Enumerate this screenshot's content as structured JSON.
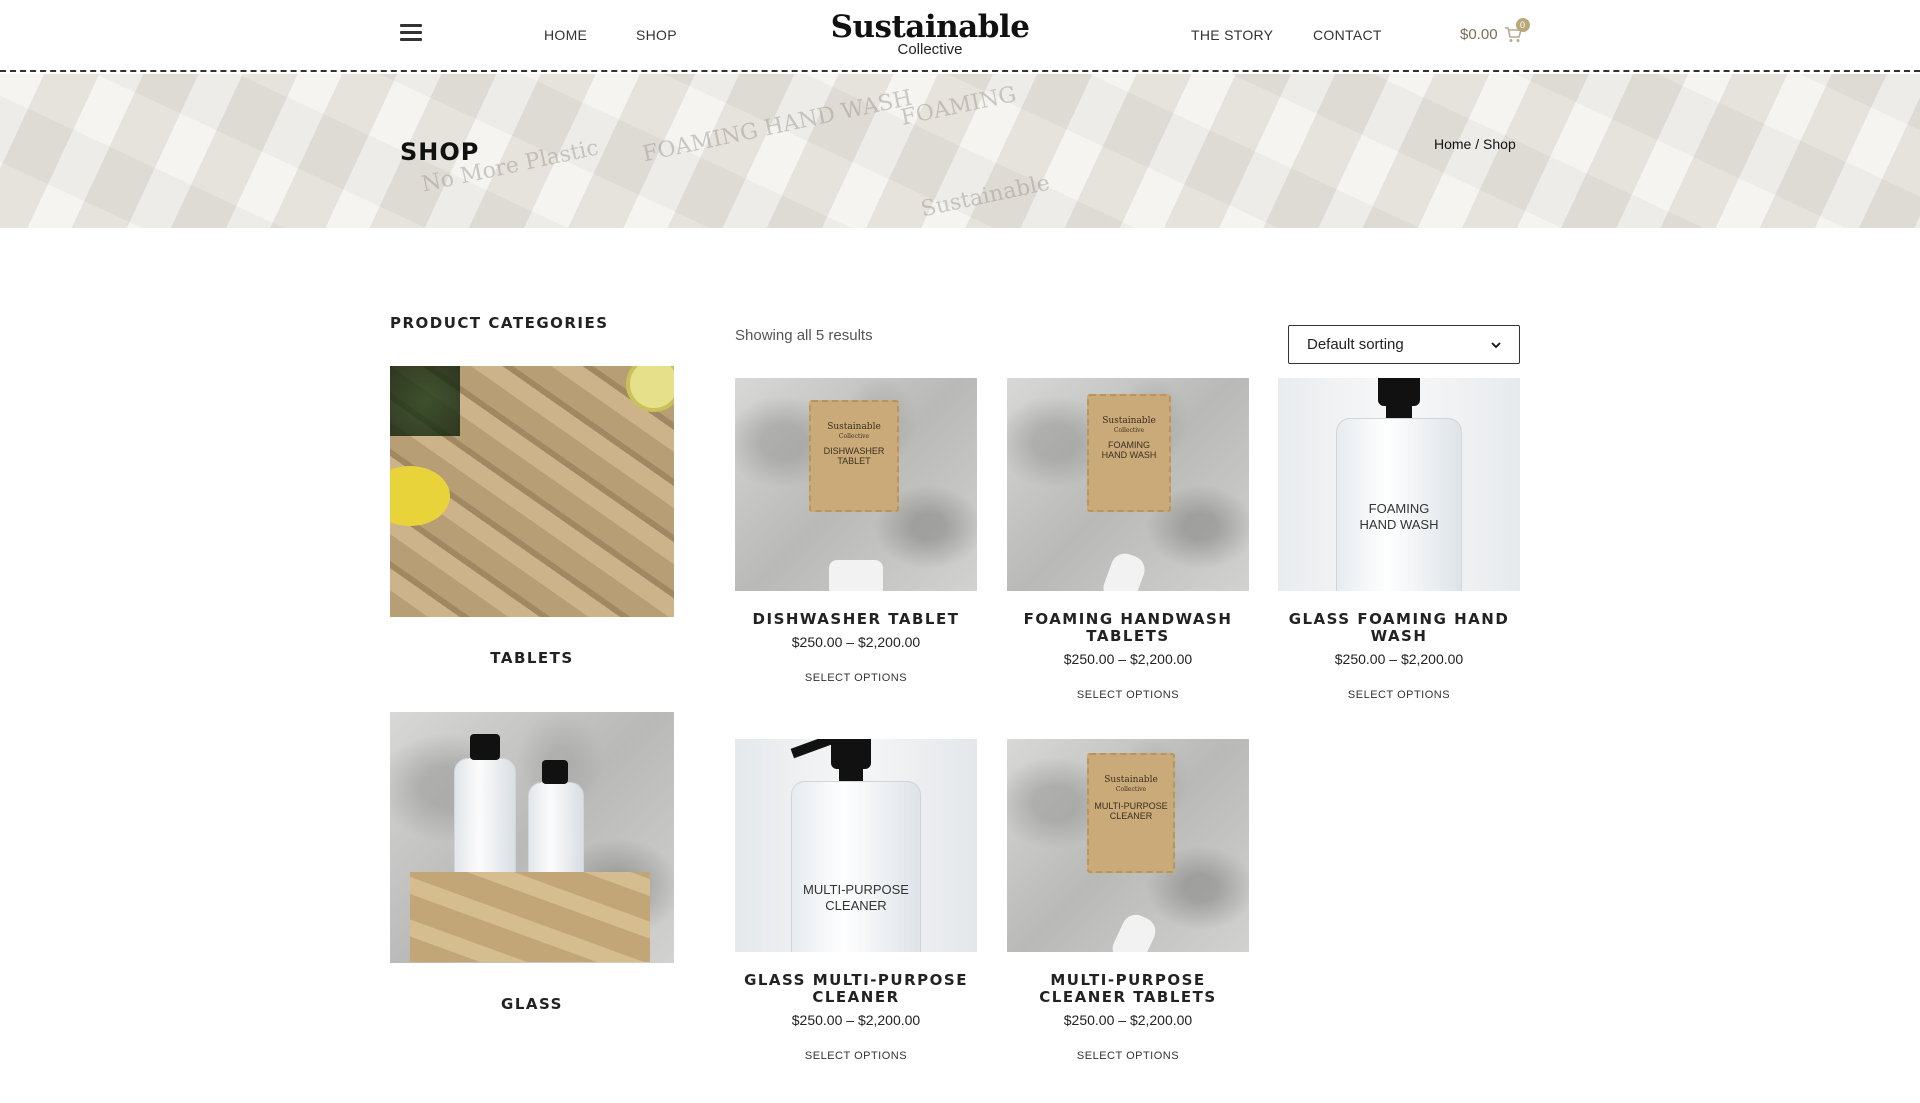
{
  "header": {
    "nav_left": [
      "HOME",
      "SHOP"
    ],
    "logo_main": "Sustainable",
    "logo_sub": "Collective",
    "nav_right": [
      "THE STORY",
      "CONTACT"
    ],
    "cart_total": "$0.00",
    "cart_count": "0"
  },
  "banner": {
    "title": "SHOP",
    "breadcrumb_home": "Home",
    "breadcrumb_sep": " / ",
    "breadcrumb_current": "Shop"
  },
  "sidebar": {
    "title": "PRODUCT CATEGORIES",
    "categories": [
      {
        "label": "TABLETS"
      },
      {
        "label": "GLASS"
      }
    ]
  },
  "toolbar": {
    "result_count": "Showing all 5 results",
    "sort_value": "Default sorting"
  },
  "products": [
    {
      "name": "DISHWASHER TABLET",
      "price": "$250.00 – $2,200.00",
      "button": "SELECT OPTIONS",
      "image_text": [
        "Sustainable",
        "Collective",
        "DISHWASHER",
        "TABLET"
      ]
    },
    {
      "name": "FOAMING HANDWASH TABLETS",
      "price": "$250.00 – $2,200.00",
      "button": "SELECT OPTIONS",
      "image_text": [
        "Sustainable",
        "Collective",
        "FOAMING",
        "HAND WASH"
      ]
    },
    {
      "name": "GLASS FOAMING HAND WASH",
      "price": "$250.00 – $2,200.00",
      "button": "SELECT OPTIONS",
      "image_text": [
        "FOAMING",
        "HAND WASH"
      ]
    },
    {
      "name": "GLASS MULTI-PURPOSE CLEANER",
      "price": "$250.00 – $2,200.00",
      "button": "SELECT OPTIONS",
      "image_text": [
        "MULTI-PURPOSE",
        "CLEANER"
      ]
    },
    {
      "name": "MULTI-PURPOSE CLEANER TABLETS",
      "price": "$250.00 – $2,200.00",
      "button": "SELECT OPTIONS",
      "image_text": [
        "Sustainable",
        "Collective",
        "MULTI-PURPOSE",
        "CLEANER"
      ]
    }
  ],
  "icons": {
    "menu": "hamburger-menu-icon",
    "cart": "shopping-cart-icon",
    "sort": "chevron-down-icon"
  },
  "colors": {
    "cart_accent": "#7a6f55",
    "badge": "#b9a87a"
  }
}
